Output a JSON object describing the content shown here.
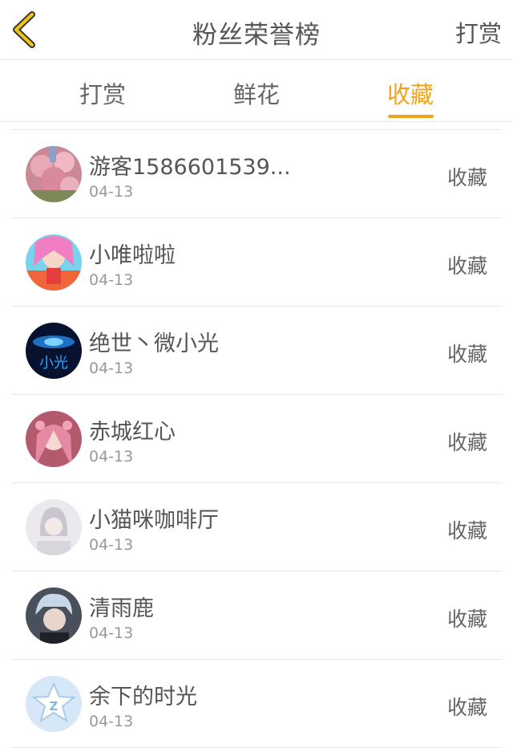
{
  "header": {
    "title": "粉丝荣誉榜",
    "action_label": "打赏",
    "back_icon": "chevron-left-icon",
    "accent_color": "#f0a21b"
  },
  "tabs": [
    {
      "label": "打赏",
      "active": false
    },
    {
      "label": "鲜花",
      "active": false
    },
    {
      "label": "收藏",
      "active": true
    }
  ],
  "list": [
    {
      "name": "游客1586601539...",
      "date": "04-13",
      "action": "收藏"
    },
    {
      "name": "小唯啦啦",
      "date": "04-13",
      "action": "收藏"
    },
    {
      "name": "绝世丶微小光",
      "date": "04-13",
      "action": "收藏"
    },
    {
      "name": "赤城红心",
      "date": "04-13",
      "action": "收藏"
    },
    {
      "name": "小猫咪咖啡厅",
      "date": "04-13",
      "action": "收藏"
    },
    {
      "name": "清雨鹿",
      "date": "04-13",
      "action": "收藏"
    },
    {
      "name": "余下的时光",
      "date": "04-13",
      "action": "收藏"
    }
  ]
}
